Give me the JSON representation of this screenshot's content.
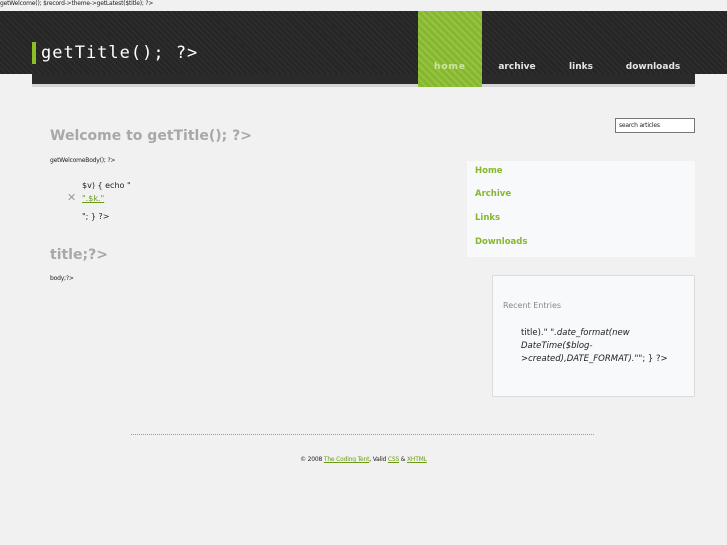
{
  "document_title": "getWelcome(); $record->theme->getLatest($title); ?>",
  "brand": {
    "text": "getTitle(); ?>"
  },
  "nav": {
    "items": [
      {
        "label": "home",
        "active": true
      },
      {
        "label": "archive",
        "active": false
      },
      {
        "label": "links",
        "active": false
      },
      {
        "label": "downloads",
        "active": false
      }
    ]
  },
  "main": {
    "welcome_heading": "Welcome to getTitle(); ?>",
    "welcome_body": "getWelcomeBody(); ?>",
    "code_line_1": "$v) { echo \"",
    "code_link": "\".$k.\"",
    "code_line_3": "\"; } ?>",
    "post_heading": "title;?>",
    "post_body": "body;?>"
  },
  "search": {
    "placeholder": "search articles"
  },
  "sidebar": {
    "links": [
      "Home",
      "Archive",
      "Links",
      "Downloads"
    ],
    "recent_title": "Recent Entries",
    "recent_entry_prefix": "title).\"",
    "recent_entry_italic": " \".date_format(new DateTime($blog->created),DATE_FORMAT).\"",
    "recent_entry_suffix": "\"; } ?>"
  },
  "footer": {
    "prefix": "© 2008 ",
    "company": "The Coding Tent",
    "middle": ", Valid ",
    "css": "CSS",
    "amp": " & ",
    "xhtml": "XHTML"
  },
  "colors": {
    "accent": "#86b82b",
    "header_bg": "#262626",
    "page_bg": "#f1f1f1"
  }
}
